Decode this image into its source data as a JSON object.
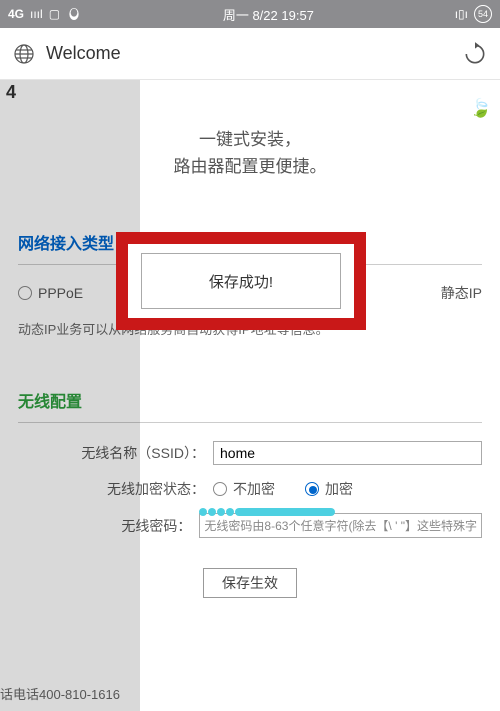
{
  "status": {
    "network": "4G",
    "datetime": "周一 8/22  19:57",
    "battery": "54"
  },
  "browser": {
    "url": "Welcome"
  },
  "hero": {
    "line1": "一键式安装，",
    "line2": "路由器配置更便捷。"
  },
  "modal": {
    "message": "保存成功!"
  },
  "wan": {
    "title": "网络接入类型",
    "opt_pppoe": "PPPoE",
    "opt_static": "静态IP",
    "help": "动态IP业务可以从网络服务商自动获得IP地址等信息。"
  },
  "wlan": {
    "title": "无线配置",
    "ssid_label": "无线名称（SSID）：",
    "ssid_value": "home",
    "enc_label": "无线加密状态：",
    "enc_none": "不加密",
    "enc_on": "加密",
    "pwd_label": "无线密码：",
    "pwd_hint": "无线密码由8-63个任意字符(除去【\\ ' \"】这些特殊字"
  },
  "actions": {
    "save": "保存生效"
  },
  "footer": {
    "phone": "话电话400-810-1616"
  }
}
